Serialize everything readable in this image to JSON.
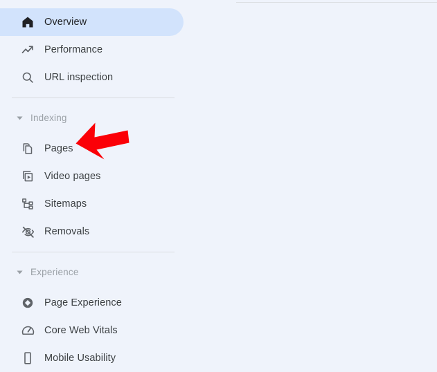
{
  "app": {
    "name": "search-console-sidebar",
    "background_color": "#eff3fb",
    "selected_item_color": "#d2e3fc",
    "divider_color": "#dadce0",
    "icon_color": "#5f6368",
    "label_color": "#3c4043",
    "section_title_color": "#9aa0a6"
  },
  "sidebar": {
    "top_group": {
      "items": [
        {
          "label": "Overview",
          "icon": "home-icon",
          "selected": true
        },
        {
          "label": "Performance",
          "icon": "trending-up-icon",
          "selected": false
        },
        {
          "label": "URL inspection",
          "icon": "search-icon",
          "selected": false
        }
      ]
    },
    "indexing_section": {
      "title": "Indexing",
      "chevron": "chevron-down-icon",
      "expanded": true,
      "items": [
        {
          "label": "Pages",
          "icon": "pages-icon",
          "selected": false
        },
        {
          "label": "Video pages",
          "icon": "video-pages-icon",
          "selected": false
        },
        {
          "label": "Sitemaps",
          "icon": "sitemaps-icon",
          "selected": false
        },
        {
          "label": "Removals",
          "icon": "eye-off-icon",
          "selected": false
        }
      ]
    },
    "experience_section": {
      "title": "Experience",
      "chevron": "chevron-down-icon",
      "expanded": true,
      "items": [
        {
          "label": "Page Experience",
          "icon": "page-experience-icon",
          "selected": false
        },
        {
          "label": "Core Web Vitals",
          "icon": "gauge-icon",
          "selected": false
        },
        {
          "label": "Mobile Usability",
          "icon": "mobile-phone-icon",
          "selected": false
        }
      ]
    }
  },
  "annotation": {
    "type": "arrow",
    "direction": "left",
    "color": "#fb0007",
    "points_at": "Pages"
  }
}
